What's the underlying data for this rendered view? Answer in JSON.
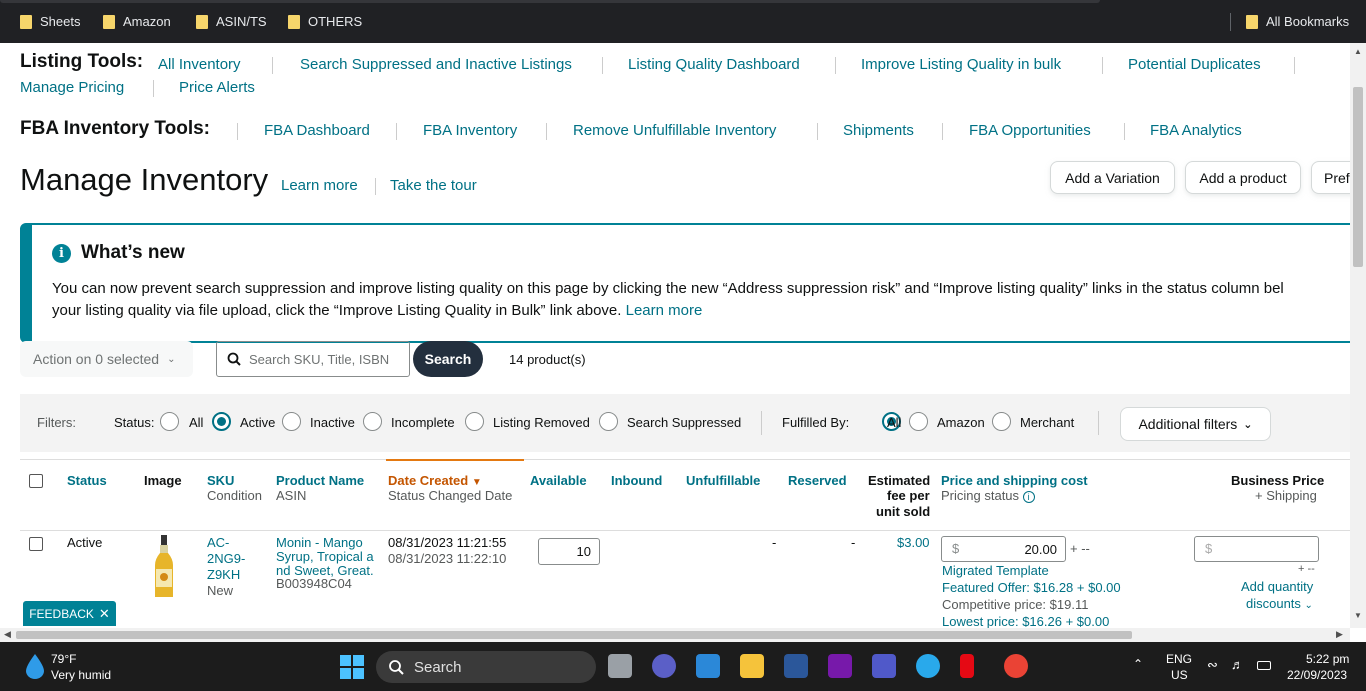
{
  "bookmarks": {
    "items": [
      "Sheets",
      "Amazon",
      "ASIN/TS",
      "OTHERS"
    ],
    "all_bookmarks": "All Bookmarks"
  },
  "listing_tools": {
    "title": "Listing Tools:",
    "links": [
      "All Inventory",
      "Search Suppressed and Inactive Listings",
      "Listing Quality Dashboard",
      "Improve Listing Quality in bulk",
      "Potential Duplicates",
      "Manage Pricing",
      "Price Alerts"
    ]
  },
  "fba_tools": {
    "title": "FBA Inventory Tools:",
    "links": [
      "FBA Dashboard",
      "FBA Inventory",
      "Remove Unfulfillable Inventory",
      "Shipments",
      "FBA Opportunities",
      "FBA Analytics"
    ]
  },
  "header": {
    "title": "Manage Inventory",
    "learn_more": "Learn more",
    "take_tour": "Take the tour",
    "add_variation": "Add a Variation",
    "add_product": "Add a product",
    "preferences": "Pref"
  },
  "whats_new": {
    "icon": "i",
    "title": "What’s new",
    "line1": "You can now prevent search suppression and improve listing quality on this page by clicking the new “Address suppression risk” and “Improve listing quality” links in the status column bel",
    "line2": "your listing quality via file upload, click the “Improve Listing Quality in Bulk” link above.",
    "learn_more": "Learn more"
  },
  "toolbar": {
    "action": "Action on 0 selected",
    "search_placeholder": "Search SKU, Title, ISBN",
    "search_button": "Search",
    "product_count": "14 product(s)"
  },
  "filters": {
    "label": "Filters:",
    "status_label": "Status:",
    "status_options": [
      "All",
      "Active",
      "Inactive",
      "Incomplete",
      "Listing Removed",
      "Search Suppressed"
    ],
    "status_selected": "Active",
    "fulfilled_label": "Fulfilled By:",
    "fulfilled_options": [
      "All",
      "Amazon",
      "Merchant"
    ],
    "fulfilled_selected": "All",
    "additional": "Additional filters"
  },
  "columns": {
    "status": "Status",
    "image": "Image",
    "sku": "SKU",
    "condition": "Condition",
    "product_name": "Product Name",
    "asin": "ASIN",
    "date_created": "Date Created",
    "status_changed": "Status Changed Date",
    "available": "Available",
    "inbound": "Inbound",
    "unfulfillable": "Unfulfillable",
    "reserved": "Reserved",
    "fee_1": "Estimated",
    "fee_2": "fee per",
    "fee_3": "unit sold",
    "price": "Price and shipping cost",
    "pricing_status": "Pricing status",
    "business_price": "Business Price",
    "shipping": "+ Shipping"
  },
  "row": {
    "status": "Active",
    "sku_1": "AC-",
    "sku_2": "2NG9-",
    "sku_3": "Z9KH",
    "condition": "New",
    "name_1": "Monin - Mango",
    "name_2": "Syrup, Tropical a",
    "name_3": "nd Sweet, Great.",
    "asin": "B003948C04",
    "date_created": "08/31/2023 11:21:55",
    "status_changed": "08/31/2023 11:22:10",
    "available": "10",
    "unfulfillable": "-",
    "reserved": "-",
    "fee": "$3.00",
    "price_symbol": "$",
    "price": "20.00",
    "price_suffix": "+ --",
    "template": "Migrated Template",
    "featured_offer": "Featured Offer: $16.28 + $0.00",
    "competitive": "Competitive price: $19.11",
    "lowest": "Lowest price: $16.26 + $0.00",
    "biz_symbol": "$",
    "biz_suffix": "+ --",
    "qty_discounts_1": "Add quantity",
    "qty_discounts_2": "discounts"
  },
  "feedback": "FEEDBACK",
  "taskbar": {
    "temp": "79°F",
    "weather": "Very humid",
    "search": "Search",
    "lang_1": "ENG",
    "lang_2": "US",
    "time": "5:22 pm",
    "date": "22/09/2023"
  }
}
